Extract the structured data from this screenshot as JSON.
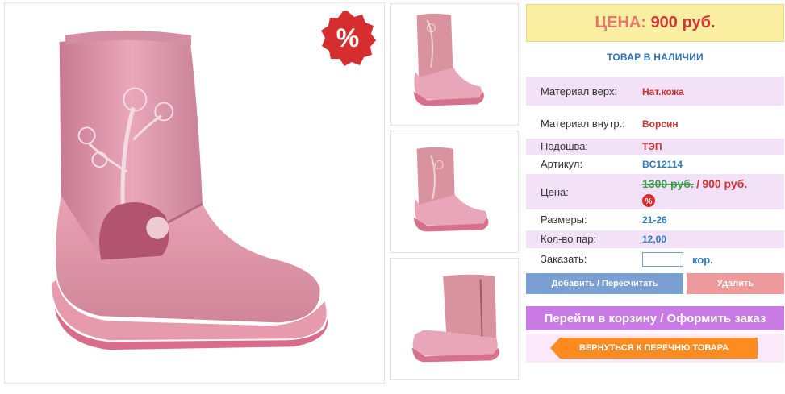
{
  "price_header": {
    "label": "ЦЕНА:",
    "value": "900 руб."
  },
  "stock_status": "ТОВАР В НАЛИЧИИ",
  "discount_badge": "%",
  "specs": [
    {
      "key": "Материал верх:",
      "value": "Нат.кожа"
    },
    {
      "key": "Материал внутр.:",
      "value": "Ворсин"
    },
    {
      "key": "Подошва:",
      "value": "ТЭП"
    },
    {
      "key": "Артикул:",
      "value": "BC12114"
    },
    {
      "key": "Цена:",
      "old_value": "1300 руб.",
      "separator": "/",
      "value": "900 руб.",
      "badge": "%"
    },
    {
      "key": "Размеры:",
      "value": "21-26"
    },
    {
      "key": "Кол-во пар:",
      "value": "12,00"
    },
    {
      "key": "Заказать:",
      "unit": "кор."
    }
  ],
  "order": {
    "quantity_value": ""
  },
  "buttons": {
    "add": "Добавить / Пересчитать",
    "delete": "Удалить",
    "cart": "Перейти в корзину / Оформить заказ",
    "back": "ВЕРНУТЬСЯ К ПЕРЕЧНЮ ТОВАРА"
  },
  "colors": {
    "boot_pink": "#e9a3b6",
    "price_header_bg": "#faeea0",
    "row_shade": "#f3e1f7",
    "add_button": "#7a9fd3",
    "delete_button": "#ee9a9a",
    "cart_button": "#c97ae4",
    "back_button": "#ff8a1f"
  }
}
